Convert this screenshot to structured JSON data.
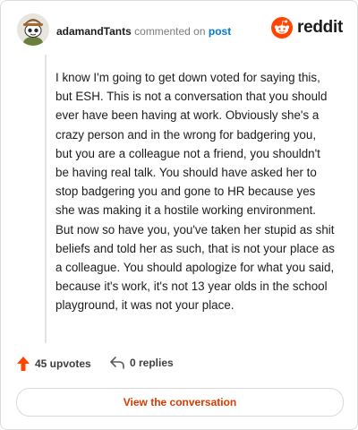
{
  "comment": {
    "username": "adamandTants",
    "action_text": "commented on",
    "post_link": "post",
    "body": "I know I'm going to get down voted for saying this, but ESH. This is not a conversation that you should ever have been having at work. Obviously she's a crazy person and in the wrong for badgering you, but you are a colleague not a friend, you shouldn't be having real talk. You should have asked her to stop badgering you and gone to HR because yes she was making it a hostile working environment. But now so have you, you've taken her stupid as shit beliefs and told her as such, that is not your place as a colleague. You should apologize for what you said, because it's work, it's not 13 year olds in the school playground, it was not your place."
  },
  "brand": {
    "name": "reddit",
    "color": "#ff4500"
  },
  "actions": {
    "upvotes_label": "45 upvotes",
    "replies_label": "0 replies"
  },
  "footer": {
    "button_label": "View the conversation"
  },
  "icons": {
    "avatar": "snoo-avatar-icon",
    "upvote": "upvote-arrow-icon",
    "reply": "reply-arrow-icon",
    "logo": "reddit-snoo-icon"
  }
}
